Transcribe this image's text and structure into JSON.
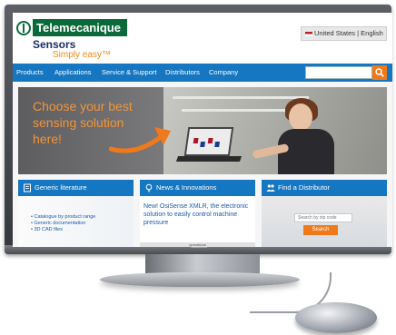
{
  "site": {
    "logo_brand": "Telemecanique",
    "logo_product": "Sensors",
    "logo_tagline": "Simply easy™"
  },
  "header": {
    "language_selector": "United States | English"
  },
  "nav": {
    "items": [
      {
        "label": "Products"
      },
      {
        "label": "Applications"
      },
      {
        "label": "Service & Support"
      },
      {
        "label": "Distributors"
      },
      {
        "label": "Company"
      }
    ],
    "search_placeholder": ""
  },
  "hero": {
    "headline": "Choose your best sensing solution here!"
  },
  "panels": {
    "literature": {
      "title": "Generic literature",
      "links": [
        "Catalogue by product range",
        "Generic documentation",
        "3D CAD files"
      ]
    },
    "news": {
      "title": "News & Innovations",
      "text": "New! OsiSense XMLR, the electronic solution to easily control machine pressure",
      "more": "more"
    },
    "distributor": {
      "title": "Find a Distributor",
      "zip_placeholder": "Search by zip code",
      "search_label": "Search"
    }
  },
  "status_bar": {
    "text": "operations"
  },
  "colors": {
    "brand_green": "#0b6a3a",
    "nav_blue": "#1576c2",
    "accent_orange": "#f07a1a",
    "link_blue": "#1b5aa8"
  }
}
